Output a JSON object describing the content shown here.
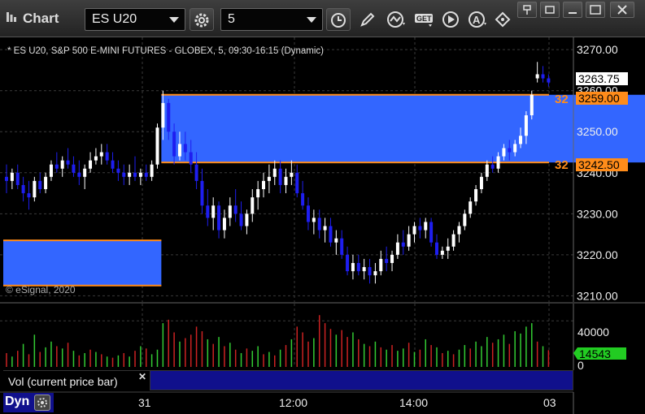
{
  "window": {
    "title": "Chart",
    "symbol": "ES U20",
    "interval": "5"
  },
  "chart_header": "* ES U20, S&P 500 E-MINI FUTURES - GLOBEX, 5, 09:30-16:15 (Dynamic)",
  "copyright": "© eSignal, 2020",
  "price_axis": {
    "ticks": [
      "3270.00",
      "3260.00",
      "3250.00",
      "3240.00",
      "3230.00",
      "3220.00",
      "3210.00"
    ],
    "last_price": "3263.75",
    "upper_line_price": "3259.00",
    "lower_line_price": "3242.50",
    "upper_line_marker": "32",
    "lower_line_marker": "32"
  },
  "volume_axis": {
    "ticks": [
      "40000",
      "0"
    ],
    "last_volume": "14543"
  },
  "volume_label": "Vol (current price bar)",
  "time_axis": {
    "labels": [
      "31",
      "12:00",
      "14:00",
      "03"
    ]
  },
  "footer": {
    "mode": "Dyn"
  },
  "colors": {
    "up": "#ffffff",
    "down": "#1e1ef0",
    "zone": "#3366ff",
    "zone_line": "#ff8c1a",
    "vol_up": "#33cc33",
    "vol_down": "#cc2222",
    "last_volume_bg": "#22cc22"
  },
  "chart_data": {
    "type": "candlestick",
    "price_range": [
      3208.5,
      3273
    ],
    "volume_range": [
      0,
      55000
    ],
    "zones": [
      {
        "top": 3259.0,
        "bottom": 3242.5,
        "start": 28,
        "end": 115
      },
      {
        "top": 3223.5,
        "bottom": 3212.5,
        "start": 0,
        "end": 28
      }
    ],
    "candles": [
      [
        3239.0,
        3242.0,
        3235.0,
        3238.0
      ],
      [
        3238.0,
        3241.0,
        3236.0,
        3240.0
      ],
      [
        3240.0,
        3242.0,
        3236.0,
        3237.0
      ],
      [
        3237.0,
        3239.0,
        3233.0,
        3235.0
      ],
      [
        3235.0,
        3238.0,
        3231.0,
        3234.0
      ],
      [
        3234.0,
        3239.0,
        3233.0,
        3238.0
      ],
      [
        3238.0,
        3240.0,
        3235.0,
        3236.0
      ],
      [
        3236.0,
        3240.0,
        3235.0,
        3239.0
      ],
      [
        3239.0,
        3243.0,
        3238.0,
        3242.0
      ],
      [
        3242.0,
        3245.0,
        3240.0,
        3241.0
      ],
      [
        3241.0,
        3244.0,
        3239.0,
        3243.0
      ],
      [
        3243.0,
        3246.0,
        3241.0,
        3242.0
      ],
      [
        3242.0,
        3244.0,
        3239.0,
        3240.0
      ],
      [
        3240.0,
        3243.0,
        3237.0,
        3239.0
      ],
      [
        3239.0,
        3242.0,
        3236.0,
        3241.0
      ],
      [
        3241.0,
        3245.0,
        3240.0,
        3243.0
      ],
      [
        3243.0,
        3246.0,
        3242.0,
        3244.0
      ],
      [
        3244.0,
        3247.0,
        3242.0,
        3245.0
      ],
      [
        3245.0,
        3247.0,
        3242.0,
        3243.0
      ],
      [
        3243.0,
        3245.0,
        3240.0,
        3241.0
      ],
      [
        3241.0,
        3243.0,
        3238.0,
        3240.0
      ],
      [
        3240.0,
        3242.0,
        3237.0,
        3239.0
      ],
      [
        3239.0,
        3242.0,
        3237.0,
        3240.0
      ],
      [
        3240.0,
        3244.0,
        3238.0,
        3239.0
      ],
      [
        3239.0,
        3241.0,
        3237.0,
        3240.0
      ],
      [
        3240.0,
        3242.0,
        3238.0,
        3239.0
      ],
      [
        3239.0,
        3243.0,
        3238.0,
        3242.0
      ],
      [
        3242.0,
        3252.0,
        3241.0,
        3251.0
      ],
      [
        3251.0,
        3260.0,
        3248.0,
        3257.0
      ],
      [
        3257.0,
        3258.0,
        3248.0,
        3250.0
      ],
      [
        3250.0,
        3252.0,
        3242.0,
        3244.0
      ],
      [
        3244.0,
        3250.0,
        3243.0,
        3247.0
      ],
      [
        3247.0,
        3250.0,
        3243.0,
        3245.0
      ],
      [
        3245.0,
        3248.0,
        3240.0,
        3242.0
      ],
      [
        3242.0,
        3245.0,
        3236.0,
        3238.0
      ],
      [
        3238.0,
        3241.0,
        3230.0,
        3232.0
      ],
      [
        3232.0,
        3236.0,
        3227.0,
        3229.0
      ],
      [
        3229.0,
        3234.0,
        3226.0,
        3232.0
      ],
      [
        3232.0,
        3233.0,
        3224.0,
        3226.0
      ],
      [
        3226.0,
        3231.0,
        3224.0,
        3229.0
      ],
      [
        3229.0,
        3234.0,
        3227.0,
        3232.0
      ],
      [
        3232.0,
        3236.0,
        3228.0,
        3230.0
      ],
      [
        3230.0,
        3233.0,
        3226.0,
        3227.0
      ],
      [
        3227.0,
        3231.0,
        3225.0,
        3230.0
      ],
      [
        3230.0,
        3236.0,
        3228.0,
        3234.0
      ],
      [
        3234.0,
        3238.0,
        3231.0,
        3236.0
      ],
      [
        3236.0,
        3240.0,
        3234.0,
        3238.0
      ],
      [
        3238.0,
        3242.0,
        3235.0,
        3239.0
      ],
      [
        3239.0,
        3243.0,
        3237.0,
        3241.0
      ],
      [
        3241.0,
        3243.0,
        3235.0,
        3237.0
      ],
      [
        3237.0,
        3241.0,
        3235.0,
        3239.0
      ],
      [
        3239.0,
        3243.0,
        3237.0,
        3240.0
      ],
      [
        3240.0,
        3242.0,
        3234.0,
        3235.0
      ],
      [
        3235.0,
        3238.0,
        3231.0,
        3232.0
      ],
      [
        3232.0,
        3234.0,
        3226.0,
        3228.0
      ],
      [
        3228.0,
        3231.0,
        3225.0,
        3229.0
      ],
      [
        3229.0,
        3231.0,
        3224.0,
        3226.0
      ],
      [
        3226.0,
        3229.0,
        3223.0,
        3227.0
      ],
      [
        3227.0,
        3229.0,
        3222.0,
        3223.0
      ],
      [
        3223.0,
        3226.0,
        3220.0,
        3224.0
      ],
      [
        3224.0,
        3226.0,
        3219.0,
        3220.0
      ],
      [
        3220.0,
        3222.0,
        3215.0,
        3216.0
      ],
      [
        3216.0,
        3220.0,
        3214.0,
        3218.0
      ],
      [
        3218.0,
        3220.0,
        3215.0,
        3216.0
      ],
      [
        3216.0,
        3219.0,
        3214.0,
        3217.0
      ],
      [
        3217.0,
        3219.0,
        3213.0,
        3215.0
      ],
      [
        3215.0,
        3218.0,
        3213.0,
        3216.0
      ],
      [
        3216.0,
        3221.0,
        3215.0,
        3219.0
      ],
      [
        3219.0,
        3222.0,
        3216.0,
        3218.0
      ],
      [
        3218.0,
        3221.0,
        3216.0,
        3220.0
      ],
      [
        3220.0,
        3225.0,
        3219.0,
        3223.0
      ],
      [
        3223.0,
        3226.0,
        3220.0,
        3222.0
      ],
      [
        3222.0,
        3227.0,
        3221.0,
        3225.0
      ],
      [
        3225.0,
        3228.0,
        3223.0,
        3227.0
      ],
      [
        3227.0,
        3229.0,
        3224.0,
        3226.0
      ],
      [
        3226.0,
        3229.0,
        3224.0,
        3228.0
      ],
      [
        3228.0,
        3229.0,
        3222.0,
        3223.0
      ],
      [
        3223.0,
        3225.0,
        3219.0,
        3220.0
      ],
      [
        3220.0,
        3222.0,
        3219.0,
        3221.0
      ],
      [
        3221.0,
        3224.0,
        3219.0,
        3222.0
      ],
      [
        3222.0,
        3226.0,
        3221.0,
        3225.0
      ],
      [
        3225.0,
        3228.0,
        3223.0,
        3227.0
      ],
      [
        3227.0,
        3231.0,
        3226.0,
        3230.0
      ],
      [
        3230.0,
        3234.0,
        3229.0,
        3233.0
      ],
      [
        3233.0,
        3237.0,
        3232.0,
        3236.0
      ],
      [
        3236.0,
        3240.0,
        3235.0,
        3239.0
      ],
      [
        3239.0,
        3243.0,
        3238.0,
        3242.0
      ],
      [
        3242.0,
        3244.0,
        3240.0,
        3241.0
      ],
      [
        3241.0,
        3245.0,
        3240.0,
        3244.0
      ],
      [
        3244.0,
        3247.0,
        3243.0,
        3246.0
      ],
      [
        3246.0,
        3248.0,
        3243.0,
        3245.0
      ],
      [
        3245.0,
        3248.0,
        3244.0,
        3247.0
      ],
      [
        3247.0,
        3251.0,
        3246.0,
        3249.0
      ],
      [
        3249.0,
        3255.0,
        3247.0,
        3254.0
      ],
      [
        3254.0,
        3260.0,
        3253.0,
        3259.0
      ],
      [
        3263.0,
        3267.0,
        3262.0,
        3264.0
      ],
      [
        3264.0,
        3266.0,
        3262.0,
        3263.0
      ],
      [
        3263.0,
        3264.0,
        3261.0,
        3262.0
      ]
    ],
    "volume": [
      [
        12000,
        "d"
      ],
      [
        9000,
        "u"
      ],
      [
        14000,
        "d"
      ],
      [
        20000,
        "u"
      ],
      [
        11000,
        "d"
      ],
      [
        28000,
        "u"
      ],
      [
        13000,
        "d"
      ],
      [
        17000,
        "u"
      ],
      [
        22000,
        "u"
      ],
      [
        18000,
        "d"
      ],
      [
        16000,
        "u"
      ],
      [
        21000,
        "d"
      ],
      [
        14000,
        "u"
      ],
      [
        10000,
        "d"
      ],
      [
        12000,
        "u"
      ],
      [
        15000,
        "d"
      ],
      [
        13000,
        "u"
      ],
      [
        11000,
        "d"
      ],
      [
        9000,
        "u"
      ],
      [
        8000,
        "d"
      ],
      [
        10000,
        "u"
      ],
      [
        12000,
        "d"
      ],
      [
        9000,
        "u"
      ],
      [
        14000,
        "d"
      ],
      [
        18000,
        "u"
      ],
      [
        16000,
        "d"
      ],
      [
        11000,
        "u"
      ],
      [
        15000,
        "u"
      ],
      [
        38000,
        "u"
      ],
      [
        41000,
        "d"
      ],
      [
        30000,
        "d"
      ],
      [
        22000,
        "u"
      ],
      [
        25000,
        "d"
      ],
      [
        28000,
        "d"
      ],
      [
        35000,
        "d"
      ],
      [
        31000,
        "d"
      ],
      [
        24000,
        "u"
      ],
      [
        20000,
        "d"
      ],
      [
        26000,
        "u"
      ],
      [
        18000,
        "d"
      ],
      [
        21000,
        "u"
      ],
      [
        15000,
        "d"
      ],
      [
        12000,
        "u"
      ],
      [
        16000,
        "d"
      ],
      [
        14000,
        "u"
      ],
      [
        18000,
        "u"
      ],
      [
        11000,
        "d"
      ],
      [
        13000,
        "u"
      ],
      [
        10000,
        "d"
      ],
      [
        15000,
        "u"
      ],
      [
        19000,
        "d"
      ],
      [
        24000,
        "u"
      ],
      [
        35000,
        "d"
      ],
      [
        30000,
        "d"
      ],
      [
        22000,
        "d"
      ],
      [
        25000,
        "u"
      ],
      [
        45000,
        "d"
      ],
      [
        38000,
        "d"
      ],
      [
        33000,
        "d"
      ],
      [
        28000,
        "u"
      ],
      [
        32000,
        "d"
      ],
      [
        26000,
        "d"
      ],
      [
        30000,
        "u"
      ],
      [
        24000,
        "d"
      ],
      [
        20000,
        "u"
      ],
      [
        18000,
        "d"
      ],
      [
        22000,
        "u"
      ],
      [
        17000,
        "d"
      ],
      [
        15000,
        "u"
      ],
      [
        19000,
        "d"
      ],
      [
        14000,
        "u"
      ],
      [
        16000,
        "u"
      ],
      [
        21000,
        "d"
      ],
      [
        13000,
        "u"
      ],
      [
        15000,
        "d"
      ],
      [
        24000,
        "u"
      ],
      [
        19000,
        "d"
      ],
      [
        17000,
        "u"
      ],
      [
        12000,
        "d"
      ],
      [
        14000,
        "u"
      ],
      [
        11000,
        "d"
      ],
      [
        15000,
        "u"
      ],
      [
        19000,
        "u"
      ],
      [
        16000,
        "d"
      ],
      [
        22000,
        "u"
      ],
      [
        18000,
        "u"
      ],
      [
        26000,
        "u"
      ],
      [
        21000,
        "d"
      ],
      [
        24000,
        "u"
      ],
      [
        28000,
        "u"
      ],
      [
        20000,
        "d"
      ],
      [
        31000,
        "u"
      ],
      [
        29000,
        "u"
      ],
      [
        35000,
        "u"
      ],
      [
        38000,
        "u"
      ],
      [
        22000,
        "d"
      ],
      [
        18000,
        "u"
      ],
      [
        14543,
        "d"
      ]
    ]
  }
}
